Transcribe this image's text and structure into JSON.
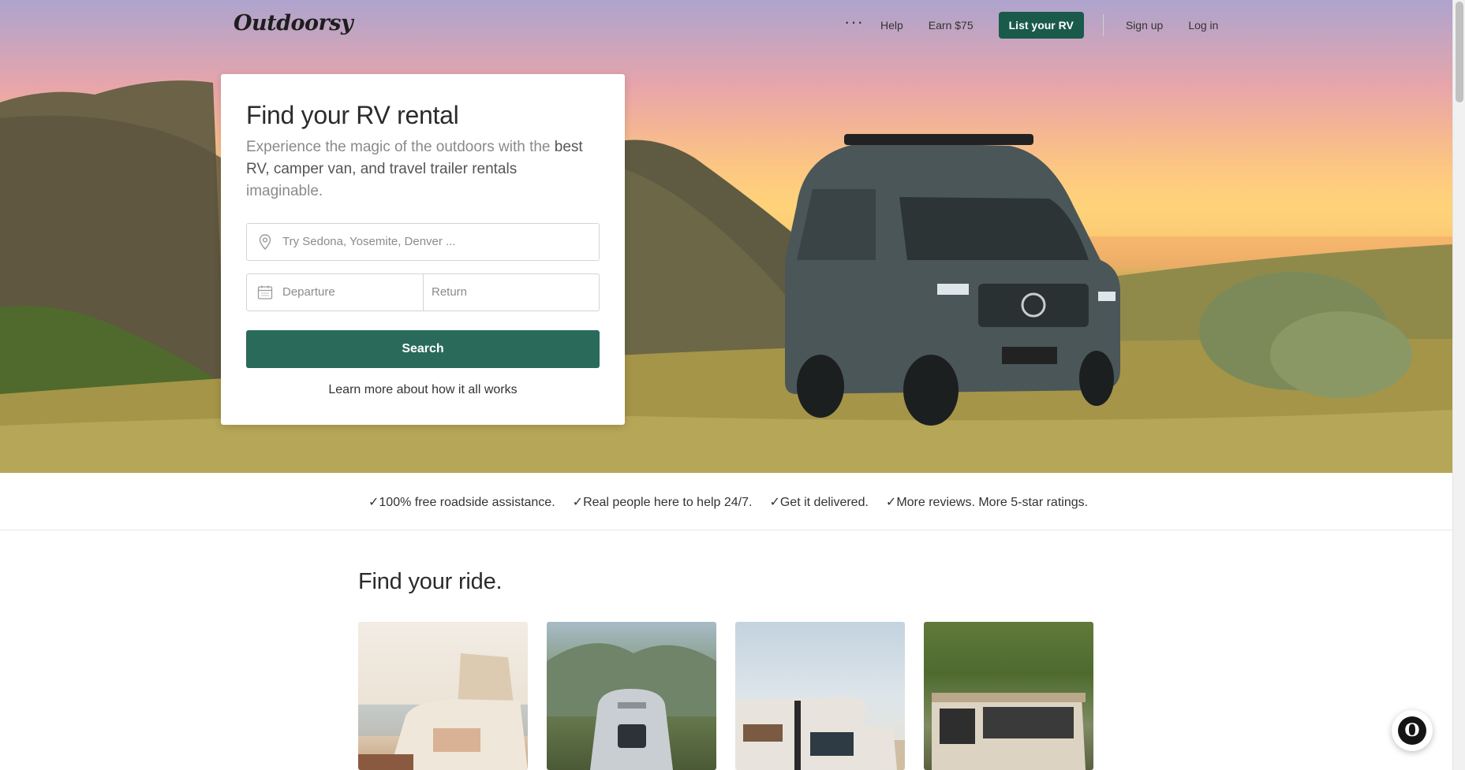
{
  "brand": {
    "logo": "Outdoorsy",
    "accent": "#1a5a4b",
    "button": "#2a6a5b"
  },
  "nav": {
    "more_icon": "ellipsis-icon",
    "links": [
      "Help",
      "Earn $75"
    ],
    "cta": "List your RV",
    "signup": "Sign up",
    "login": "Log in"
  },
  "search_card": {
    "title": "Find your RV rental",
    "subtitle_plain": "Experience the magic of the outdoors with the ",
    "subtitle_strong": "best RV, camper van, and travel trailer rentals",
    "subtitle_end": " imaginable.",
    "location": {
      "placeholder": "Try Sedona, Yosemite, Denver ...",
      "icon": "map-pin-icon"
    },
    "departure": {
      "placeholder": "Departure",
      "icon": "calendar-icon"
    },
    "return": {
      "placeholder": "Return"
    },
    "search_label": "Search",
    "learn_more": "Learn more about how it all works"
  },
  "value_props": [
    "✓100% free roadside assistance.",
    "✓Real people here to help 24/7.",
    "✓Get it delivered.",
    "✓More reviews. More 5-star ratings."
  ],
  "ride_section": {
    "title": "Find your ride."
  },
  "chat": {
    "icon": "outdoorsy-chat-icon",
    "glyph": "O"
  }
}
